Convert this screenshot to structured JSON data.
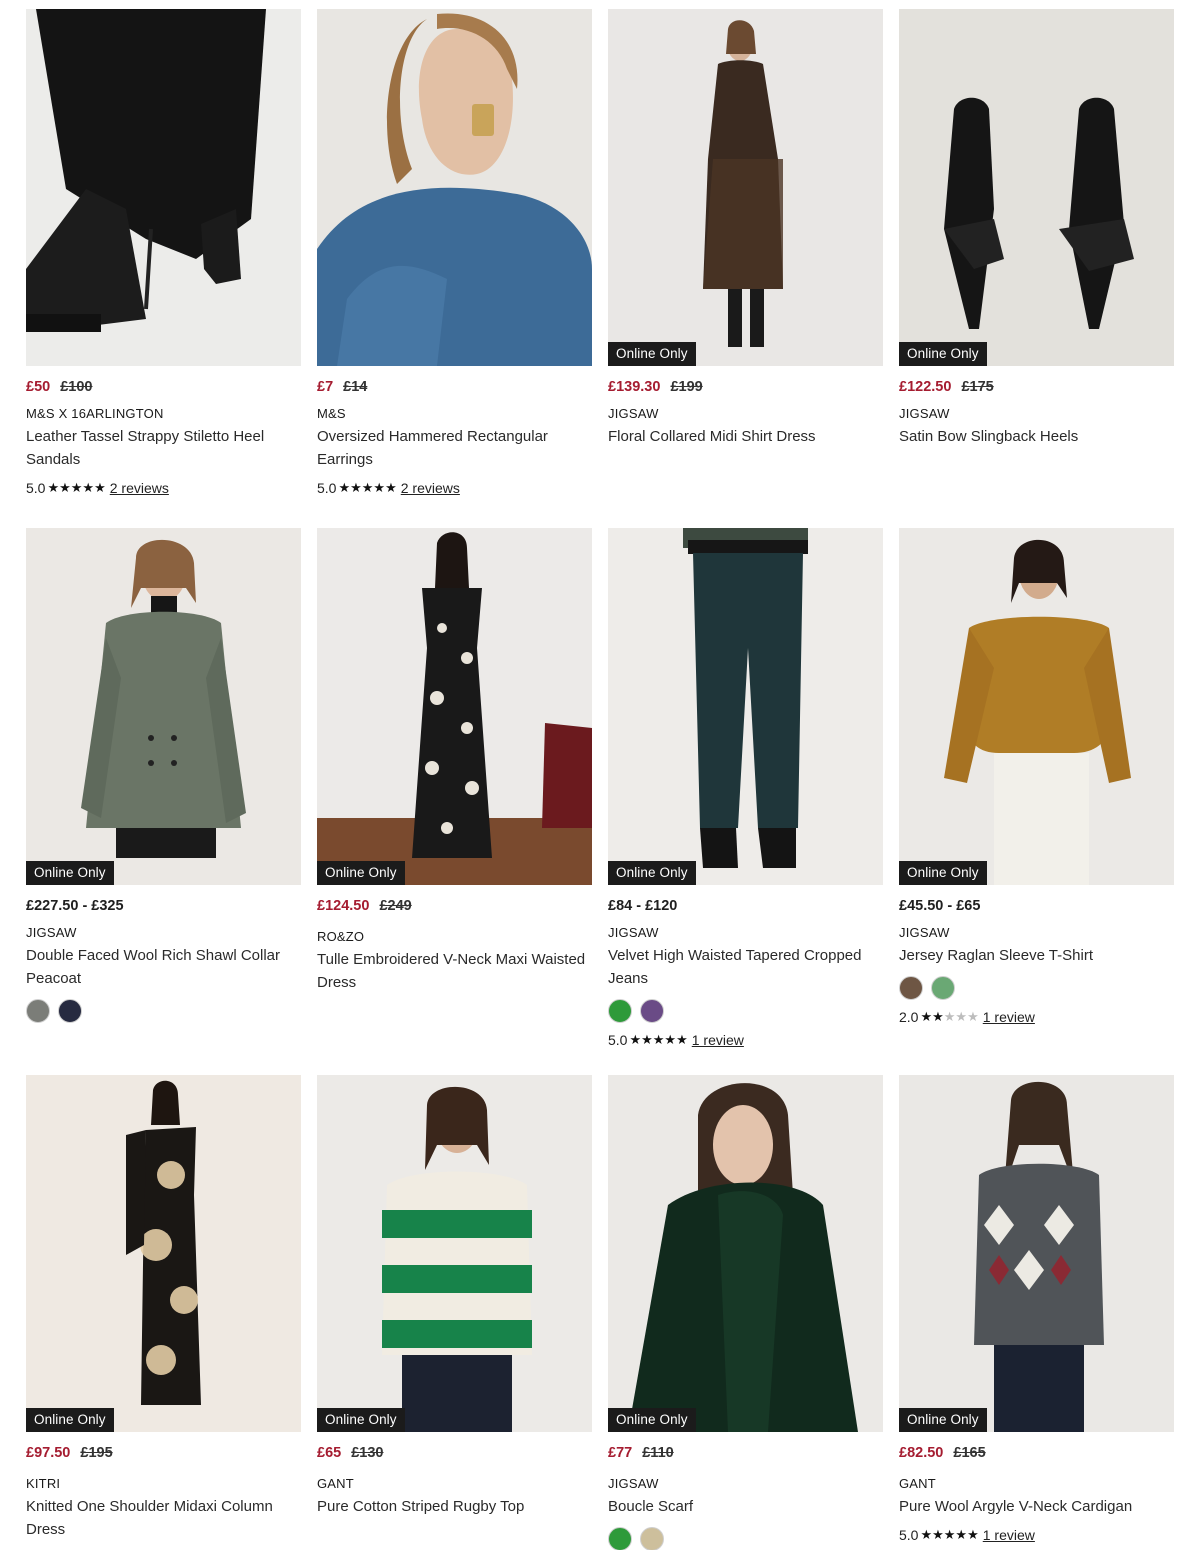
{
  "products": [
    {
      "badge": "",
      "price_now": "£50",
      "price_was": "£100",
      "sale": true,
      "brand": "M&S X 16ARLINGTON",
      "title": "Leather Tassel Strappy Stiletto Heel Sandals",
      "rating": "5.0",
      "stars": 5,
      "reviews": "2 reviews",
      "swatches": [],
      "image": "tassel-boot-image"
    },
    {
      "badge": "",
      "price_now": "£7",
      "price_was": "£14",
      "sale": true,
      "brand": "M&S",
      "title": "Oversized Hammered Rectangular Earrings",
      "rating": "5.0",
      "stars": 5,
      "reviews": "2 reviews",
      "swatches": [],
      "image": "earrings-model-image"
    },
    {
      "badge": "Online Only",
      "price_now": "£139.30",
      "price_was": "£199",
      "sale": true,
      "brand": "JIGSAW",
      "title": "Floral Collared Midi Shirt Dress",
      "rating": "",
      "stars": 0,
      "reviews": "",
      "swatches": [],
      "image": "midi-dress-image"
    },
    {
      "badge": "Online Only",
      "price_now": "£122.50",
      "price_was": "£175",
      "sale": true,
      "brand": "JIGSAW",
      "title": "Satin Bow Slingback Heels",
      "rating": "",
      "stars": 0,
      "reviews": "",
      "swatches": [],
      "image": "slingback-heels-image"
    },
    {
      "badge": "Online Only",
      "price_now": "£227.50 - £325",
      "price_was": "",
      "sale": false,
      "brand": "JIGSAW",
      "title": "Double Faced Wool Rich Shawl Collar Peacoat",
      "rating": "",
      "stars": 0,
      "reviews": "",
      "swatches": [
        "#7b7d78",
        "#262a40"
      ],
      "image": "peacoat-image"
    },
    {
      "badge": "Online Only",
      "price_now": "£124.50",
      "price_was": "£249",
      "sale": true,
      "brand": "RO&ZO",
      "title": "Tulle Embroidered V-Neck Maxi Waisted Dress",
      "rating": "",
      "stars": 0,
      "reviews": "",
      "swatches": [],
      "image": "maxi-dress-image"
    },
    {
      "badge": "Online Only",
      "price_now": "£84 - £120",
      "price_was": "",
      "sale": false,
      "brand": "JIGSAW",
      "title": "Velvet High Waisted Tapered Cropped Jeans",
      "rating": "5.0",
      "stars": 5,
      "reviews": "1 review",
      "swatches": [
        "#2e9a3a",
        "#6a4b86"
      ],
      "image": "velvet-jeans-image"
    },
    {
      "badge": "Online Only",
      "price_now": "£45.50 - £65",
      "price_was": "",
      "sale": false,
      "brand": "JIGSAW",
      "title": "Jersey Raglan Sleeve T-Shirt",
      "rating": "2.0",
      "stars": 2,
      "reviews": "1 review",
      "swatches": [
        "#6e5644",
        "#6aa874"
      ],
      "image": "raglan-tshirt-image"
    },
    {
      "badge": "Online Only",
      "price_now": "£97.50",
      "price_was": "£195",
      "sale": true,
      "brand": "KITRI",
      "title": "Knitted One Shoulder Midaxi Column Dress",
      "rating": "",
      "stars": 0,
      "reviews": "",
      "swatches": [],
      "image": "column-dress-image"
    },
    {
      "badge": "Online Only",
      "price_now": "£65",
      "price_was": "£130",
      "sale": true,
      "brand": "GANT",
      "title": "Pure Cotton Striped Rugby Top",
      "rating": "",
      "stars": 0,
      "reviews": "",
      "swatches": [],
      "image": "rugby-top-image"
    },
    {
      "badge": "Online Only",
      "price_now": "£77",
      "price_was": "£110",
      "sale": true,
      "brand": "JIGSAW",
      "title": "Boucle Scarf",
      "rating": "",
      "stars": 0,
      "reviews": "",
      "swatches": [
        "#2e9a3a",
        "#cdbf9c"
      ],
      "image": "boucle-scarf-image"
    },
    {
      "badge": "Online Only",
      "price_now": "£82.50",
      "price_was": "£165",
      "sale": true,
      "brand": "GANT",
      "title": "Pure Wool Argyle V-Neck Cardigan",
      "rating": "5.0",
      "stars": 5,
      "reviews": "1 review",
      "swatches": [],
      "image": "argyle-cardigan-image"
    }
  ]
}
